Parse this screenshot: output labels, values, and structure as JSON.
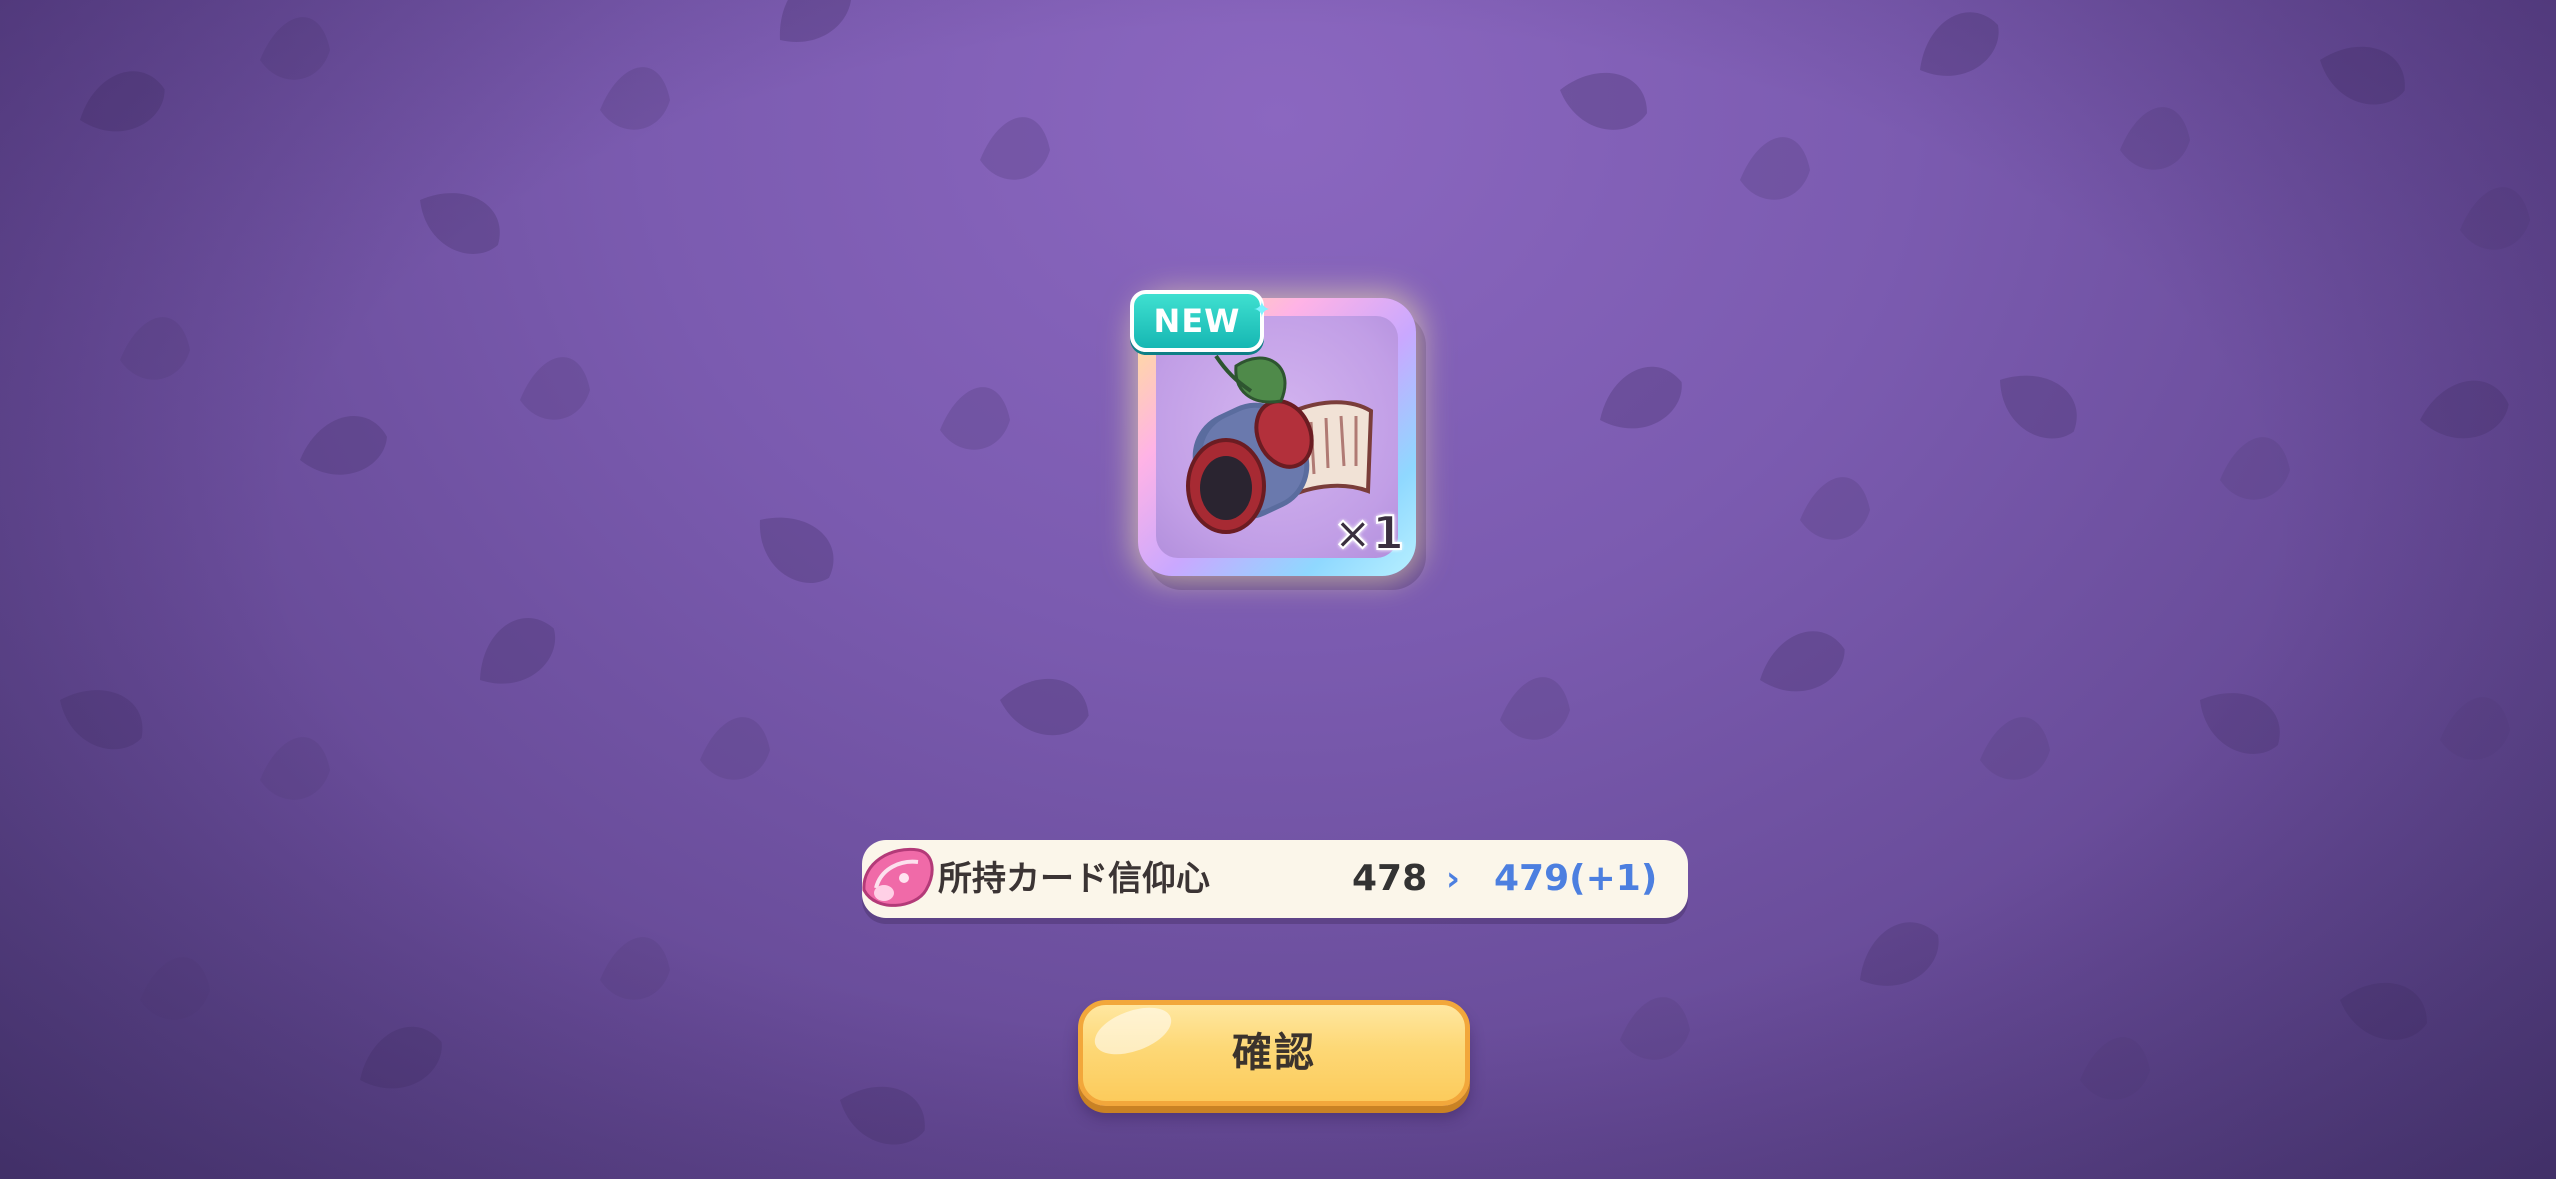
{
  "colors": {
    "background": "#7b5bb0",
    "accent_blue": "#4c7fe0",
    "button_yellow": "#fdd876",
    "badge_teal": "#16b7b3"
  },
  "reward": {
    "badge": "NEW",
    "quantity": "×1",
    "icon": "scroll-book-with-leaf"
  },
  "stat": {
    "icon": "pink-shell-icon",
    "label": "所持カード信仰心",
    "old_value": "478",
    "arrow": "›",
    "new_value": "479(+1)"
  },
  "confirm_button": {
    "label": "確認"
  }
}
